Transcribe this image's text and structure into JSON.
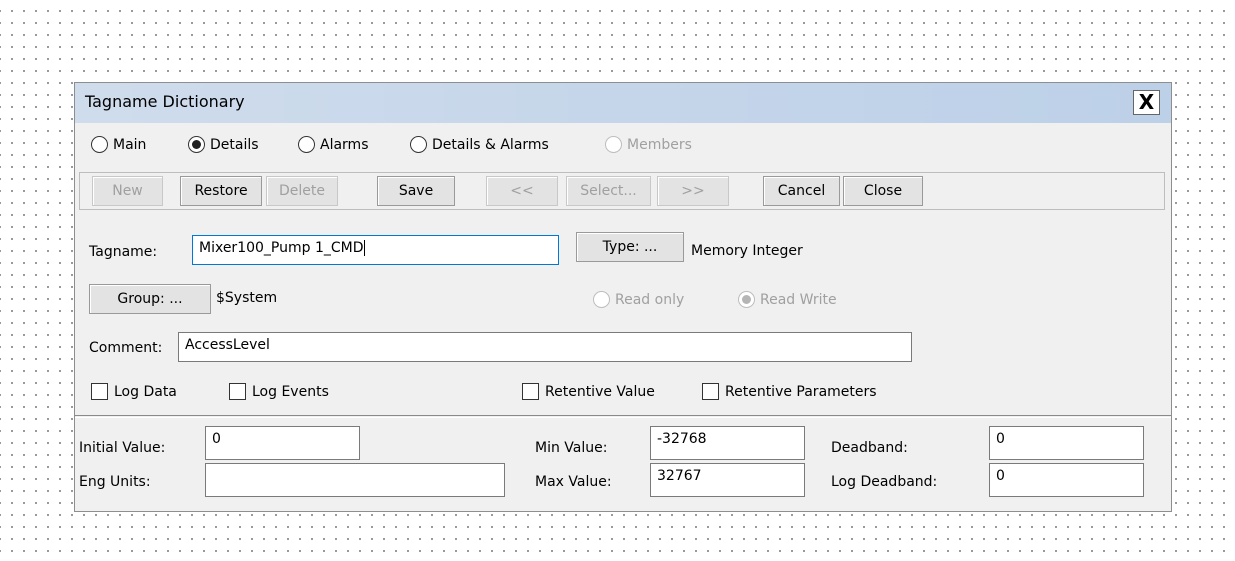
{
  "dialog": {
    "title": "Tagname Dictionary",
    "close_label": "X"
  },
  "view_options": [
    {
      "label": "Main",
      "checked": false,
      "enabled": true
    },
    {
      "label": "Details",
      "checked": true,
      "enabled": true
    },
    {
      "label": "Alarms",
      "checked": false,
      "enabled": true
    },
    {
      "label": "Details & Alarms",
      "checked": false,
      "enabled": true
    },
    {
      "label": "Members",
      "checked": false,
      "enabled": false
    }
  ],
  "toolbar": {
    "new": "New",
    "restore": "Restore",
    "delete": "Delete",
    "save": "Save",
    "prev": "<<",
    "select": "Select...",
    "next": ">>",
    "cancel": "Cancel",
    "close": "Close"
  },
  "tag": {
    "tagname_label": "Tagname:",
    "tagname_value": "Mixer100_Pump 1_CMD",
    "type_button": "Type: ...",
    "type_value": "Memory Integer",
    "group_button": "Group: ...",
    "group_value": "$System",
    "read_only_label": "Read only",
    "read_write_label": "Read Write",
    "comment_label": "Comment:",
    "comment_value": "AccessLevel"
  },
  "checkboxes": {
    "log_data": "Log Data",
    "log_events": "Log Events",
    "retentive_value": "Retentive Value",
    "retentive_parameters": "Retentive Parameters"
  },
  "details": {
    "initial_value_label": "Initial Value:",
    "initial_value": "0",
    "eng_units_label": "Eng Units:",
    "eng_units": "",
    "min_value_label": "Min Value:",
    "min_value": "-32768",
    "max_value_label": "Max Value:",
    "max_value": "32767",
    "deadband_label": "Deadband:",
    "deadband": "0",
    "log_deadband_label": "Log Deadband:",
    "log_deadband": "0"
  },
  "colors": {
    "titlebar": "#c4d5ea",
    "dialog_bg": "#f0f0f0",
    "focus_border": "#0078d7"
  }
}
